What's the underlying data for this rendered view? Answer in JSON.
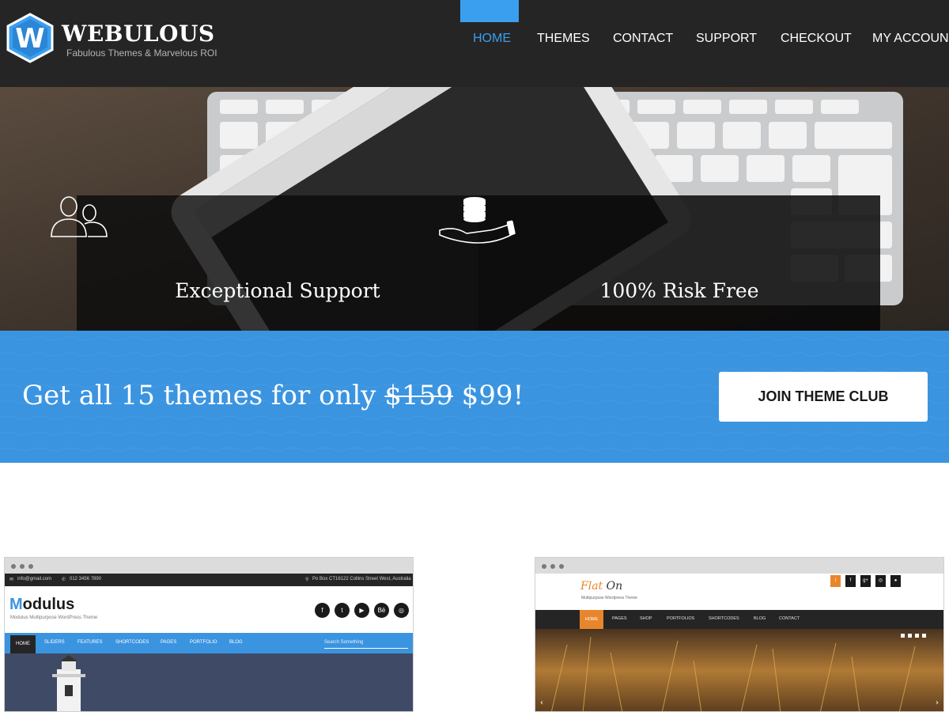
{
  "header": {
    "brand": "WEBULOUS",
    "tagline": "Fabulous Themes & Marvelous ROI",
    "logo_letter": "W",
    "nav": [
      {
        "label": "HOME",
        "active": true
      },
      {
        "label": "THEMES",
        "active": false
      },
      {
        "label": "CONTACT",
        "active": false
      },
      {
        "label": "SUPPORT",
        "active": false
      },
      {
        "label": "CHECKOUT",
        "active": false
      },
      {
        "label": "MY ACCOUNT",
        "active": false
      }
    ]
  },
  "features": [
    {
      "title": "Exceptional Support",
      "icon": "users-icon"
    },
    {
      "title": "100% Risk Free",
      "icon": "coins-in-hand-icon"
    }
  ],
  "promo": {
    "text_before": "Get all 15 themes for only",
    "old_price": "$159",
    "new_price": "$99!",
    "button_label": "JOIN THEME CLUB"
  },
  "previews": [
    {
      "name": "Modulus",
      "logo_first": "M",
      "logo_rest": "odulus",
      "subtitle": "Modulus Multipurpose WordPress Theme",
      "email": "info@gmail.com",
      "phone": "012 3456 7890",
      "address": "Po Box CT16122 Collins Street West, Australia",
      "social": [
        "f",
        "t",
        "▶",
        "Bē",
        "◎"
      ],
      "nav": [
        "HOME",
        "SLIDERS",
        "FEATURES",
        "SHORTCODES",
        "PAGES",
        "PORTFOLIO",
        "BLOG"
      ],
      "search_placeholder": "Search Something"
    },
    {
      "name": "Flat On",
      "logo_first": "Flat",
      "logo_rest": " On",
      "subtitle": "Multipurpose Wordpress Theme",
      "social": [
        "t",
        "f",
        "g+",
        "◎",
        "●"
      ],
      "nav": [
        "HOME",
        "PAGES",
        "SHOP",
        "PORTFOLIOS",
        "SHORTCODES",
        "BLOG",
        "CONTACT"
      ]
    }
  ],
  "colors": {
    "header_bg": "#252525",
    "accent": "#3b9ff0",
    "promo_bg": "#3b94e0",
    "flaton_accent": "#e8862d"
  }
}
